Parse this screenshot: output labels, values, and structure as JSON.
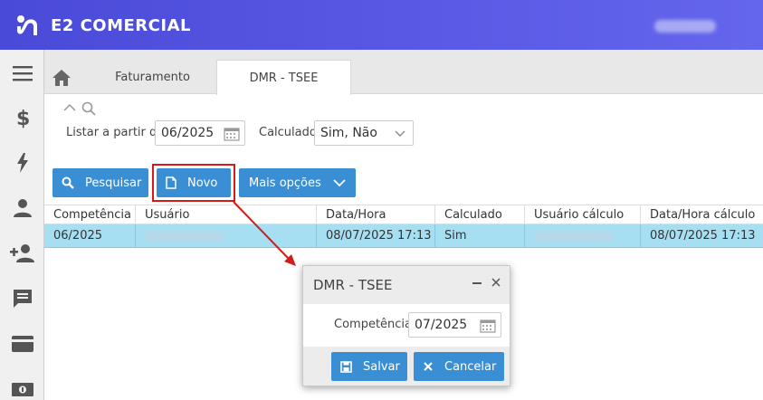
{
  "header": {
    "brand": "E2 COMERCIAL"
  },
  "sidebar": {
    "items": [
      {
        "name": "menu-icon"
      },
      {
        "name": "dollar-icon"
      },
      {
        "name": "bolt-icon"
      },
      {
        "name": "user-icon"
      },
      {
        "name": "add-user-icon"
      },
      {
        "name": "comment-icon"
      },
      {
        "name": "card-icon"
      },
      {
        "name": "cash-icon"
      }
    ]
  },
  "tabs": [
    {
      "label": "Faturamento",
      "active": false
    },
    {
      "label": "DMR - TSEE",
      "active": true
    }
  ],
  "filters": {
    "listar_label": "Listar a partir de",
    "listar_value": "06/2025",
    "calculado_label": "Calculado",
    "calculado_value": "Sim, Não"
  },
  "toolbar": {
    "pesquisar": "Pesquisar",
    "novo": "Novo",
    "mais_opcoes": "Mais opções"
  },
  "grid": {
    "columns": [
      "Competência",
      "Usuário",
      "Data/Hora",
      "Calculado",
      "Usuário cálculo",
      "Data/Hora cálculo"
    ],
    "rows": [
      {
        "competencia": "06/2025",
        "usuario": "",
        "data_hora": "08/07/2025 17:13",
        "calculado": "Sim",
        "usuario_calculo": "",
        "data_hora_calculo": "08/07/2025 17:13"
      }
    ]
  },
  "dialog": {
    "title": "DMR - TSEE",
    "competencia_label": "Competência",
    "competencia_value": "07/2025",
    "salvar": "Salvar",
    "cancelar": "Cancelar"
  },
  "colors": {
    "header": "#5050e0",
    "button": "#3a8fd4",
    "selected_row": "#a7dff2",
    "highlight": "#d21c1c"
  }
}
